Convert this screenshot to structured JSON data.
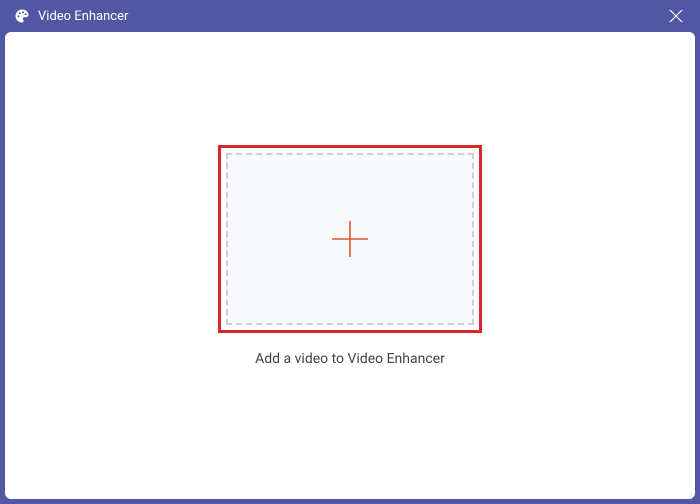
{
  "app": {
    "title": "Video Enhancer"
  },
  "main": {
    "instruction": "Add a video to Video Enhancer"
  },
  "colors": {
    "header": "#5057a3",
    "highlight_border": "#d4282a",
    "plus": "#e2572e",
    "inner_bg": "#f7f9fd",
    "dashed_border": "#cfcfcf"
  }
}
